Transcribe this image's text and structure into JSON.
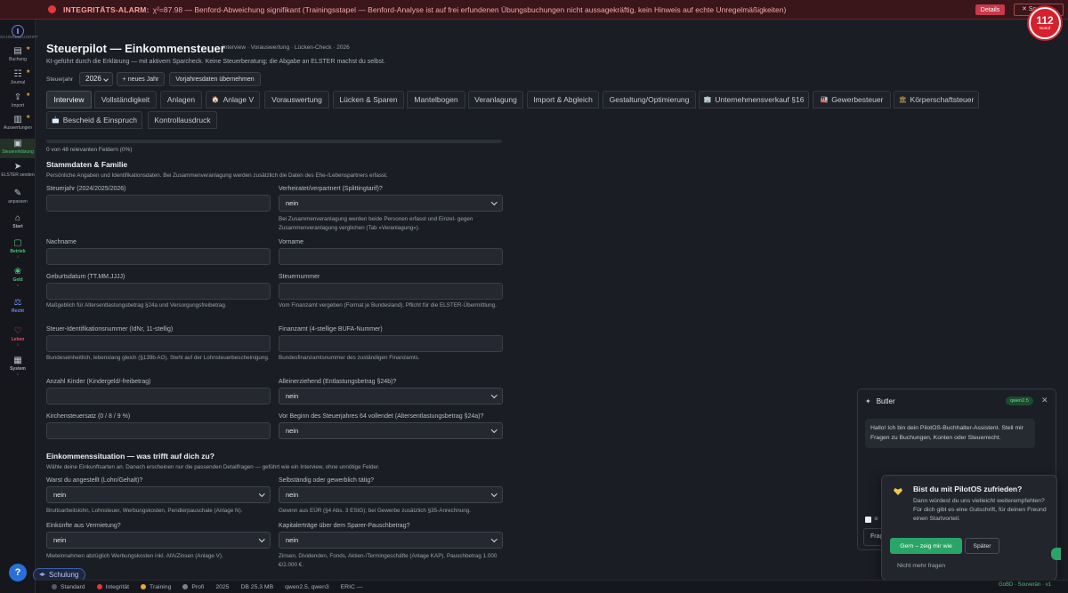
{
  "alarm": {
    "title": "INTEGRITÄTS-ALARM:",
    "message": "χ²=87.98 — Benford-Abweichung signifikant (Trainingsstapel — Benford-Analyse ist auf frei erfundenen Übungsbuchungen nicht aussagekräftig, kein Hinweis auf echte Unregelmäßigkeiten)",
    "details_label": "Details",
    "close_label": "✕ Sc",
    "badge_number": "112",
    "badge_label": "Notruf"
  },
  "sidebar": {
    "header": "SCHNELLZUGRIFF",
    "items": [
      {
        "label": "Buchung",
        "icon": "document-icon",
        "glyph": "▤"
      },
      {
        "label": "Journal",
        "icon": "journal-icon",
        "glyph": "☷"
      },
      {
        "label": "Import",
        "icon": "import-icon",
        "glyph": "⇪"
      },
      {
        "label": "Auswertungen",
        "icon": "chart-icon",
        "glyph": "▥"
      },
      {
        "label": "Steuererklärung",
        "icon": "tax-document-icon",
        "glyph": "▣"
      },
      {
        "label": "ELSTER senden",
        "icon": "send-icon",
        "glyph": "➤"
      },
      {
        "label": "anpassen",
        "icon": "pencil-icon",
        "glyph": "✎"
      }
    ],
    "groups": [
      {
        "label": "Start",
        "icon": "home-icon",
        "glyph": "⌂",
        "sub": ""
      },
      {
        "label": "Betrieb",
        "icon": "briefcase-icon",
        "glyph": "▢",
        "sub": "1"
      },
      {
        "label": "Geld",
        "icon": "money-icon",
        "glyph": "❀",
        "sub": "1"
      },
      {
        "label": "Recht",
        "icon": "law-icon",
        "glyph": "⚖",
        "sub": ""
      },
      {
        "label": "Leben",
        "icon": "heart-icon",
        "glyph": "♡",
        "sub": "1"
      },
      {
        "label": "System",
        "icon": "grid-icon",
        "glyph": "▦",
        "sub": "1"
      }
    ],
    "help_label": "?",
    "training_label": "Schulung"
  },
  "header": {
    "title": "Steuerpilot — Einkommensteuer",
    "breadcrumb": "Interview · Vorauswertung · Lücken-Check · 2026",
    "lead": "KI-geführt durch die Erklärung — mit aktivem Sparcheck. Keine Steuerberatung; die Abgabe an ELSTER machst du selbst.",
    "year_label": "Steuerjahr",
    "year_value": "2026",
    "new_year_label": "+ neues Jahr",
    "prior_year_label": "Vorjahresdaten übernehmen"
  },
  "tabs": [
    {
      "label": "Interview",
      "emoji": ""
    },
    {
      "label": "Vollständigkeit",
      "emoji": ""
    },
    {
      "label": "Anlagen",
      "emoji": ""
    },
    {
      "label": "Anlage V",
      "emoji": "🏠"
    },
    {
      "label": "Vorauswertung",
      "emoji": ""
    },
    {
      "label": "Lücken & Sparen",
      "emoji": ""
    },
    {
      "label": "Mantelbogen",
      "emoji": ""
    },
    {
      "label": "Veranlagung",
      "emoji": ""
    },
    {
      "label": "Import & Abgleich",
      "emoji": ""
    },
    {
      "label": "Gestaltung/Optimierung",
      "emoji": ""
    },
    {
      "label": "Unternehmensverkauf §16",
      "emoji": "🏢"
    },
    {
      "label": "Gewerbesteuer",
      "emoji": "🏭"
    },
    {
      "label": "Körperschaftsteuer",
      "emoji": "🏛"
    },
    {
      "label": "Bescheid & Einspruch",
      "emoji": "📩"
    },
    {
      "label": "Kontrollausdruck",
      "emoji": ""
    }
  ],
  "progress": {
    "text": "0 von 48 relevanten Feldern (0%)",
    "fraction": 0
  },
  "section1": {
    "title": "Stammdaten & Familie",
    "desc": "Persönliche Angaben und Identifikationsdaten. Bei Zusammenveranlagung werden zusätzlich die Daten des Ehe-/Lebenspartners erfasst.",
    "fields": {
      "steuerjahr": {
        "label": "Steuerjahr (2024/2025/2026)",
        "value": ""
      },
      "verheiratet": {
        "label": "Verheiratet/verpartnert (Splittingtarif)?",
        "value": "nein",
        "hint": "Bei Zusammenveranlagung werden beide Personen erfasst und Einzel- gegen Zusammenveranlagung verglichen (Tab »Veranlagung«)."
      },
      "nachname": {
        "label": "Nachname",
        "value": ""
      },
      "vorname": {
        "label": "Vorname",
        "value": ""
      },
      "geburtsdatum": {
        "label": "Geburtsdatum (TT.MM.JJJJ)",
        "value": "",
        "hint": "Maßgeblich für Altersentlastungsbetrag §24a und Versorgungsfreibetrag."
      },
      "steuernummer": {
        "label": "Steuernummer",
        "value": "",
        "hint": "Vom Finanzamt vergeben (Format je Bundesland). Pflicht für die ELSTER-Übermittlung."
      },
      "idnr": {
        "label": "Steuer-Identifikationsnummer (IdNr, 11-stellig)",
        "value": "",
        "hint": "Bundeseinheitlich, lebenslang gleich (§139b AO). Steht auf der Lohnsteuerbescheinigung."
      },
      "finanzamt": {
        "label": "Finanzamt (4-stellige BUFA-Nummer)",
        "value": "",
        "hint": "Bundesfinanzamtsnummer des zuständigen Finanzamts."
      },
      "kinder": {
        "label": "Anzahl Kinder (Kindergeld/-freibetrag)",
        "value": ""
      },
      "alleinerziehend": {
        "label": "Alleinerziehend (Entlastungsbetrag §24b)?",
        "value": "nein"
      },
      "kirchensteuer": {
        "label": "Kirchensteuersatz (0 / 8 / 9 %)",
        "value": ""
      },
      "vollendet64": {
        "label": "Vor Beginn des Steuerjahres 64 vollendet (Altersentlastungsbetrag §24a)?",
        "value": "nein"
      }
    }
  },
  "section2": {
    "title": "Einkommenssituation — was trifft auf dich zu?",
    "desc": "Wähle deine Einkunftsarten an. Danach erscheinen nur die passenden Detailfragen — geführt wie ein Interview, ohne unnötige Felder.",
    "fields": {
      "angestellt": {
        "label": "Warst du angestellt (Lohn/Gehalt)?",
        "value": "nein",
        "hint": "Bruttoarbeitslohn, Lohnsteuer, Werbungskosten, Pendlerpauschale (Anlage N)."
      },
      "selbststaendig": {
        "label": "Selbständig oder gewerblich tätig?",
        "value": "nein",
        "hint": "Gewinn aus EÜR (§4 Abs. 3 EStG); bei Gewerbe zusätzlich §35-Anrechnung."
      },
      "vermietung": {
        "label": "Einkünfte aus Vermietung?",
        "value": "nein",
        "hint": "Mieteinnahmen abzüglich Werbungskosten inkl. AfA/Zinsen (Anlage V)."
      },
      "kapital": {
        "label": "Kapitalerträge über dem Sparer-Pauschbetrag?",
        "value": "nein",
        "hint": "Zinsen, Dividenden, Fonds, Aktien-/Termingeschäfte (Anlage KAP). Pauschbetrag 1.000 €/2.000 €."
      }
    }
  },
  "butler": {
    "title": "Butler",
    "model": "qwen2.5",
    "close": "✕",
    "message": "Hallo! Ich bin dein PilotOS-Buchhalter-Assistent. Stell mir Fragen zu Buchungen, Konten oder Steuerrecht.",
    "checkbox_text": "⊕",
    "input_prefix": "Frag"
  },
  "survey": {
    "title": "Bist du mit PilotOS zufrieden?",
    "text": "Dann würdest du uns vielleicht weiterempfehlen? Für dich gibt es eine Gutschrift, für deinen Freund einen Startvorteil.",
    "yes_label": "Gern – zeig mir wie",
    "later_label": "Später",
    "never_label": "Nicht mehr fragen"
  },
  "statusbar": {
    "items": [
      {
        "label": "Standard",
        "color": "#555b66"
      },
      {
        "label": "Integrität",
        "color": "#e03a3a"
      },
      {
        "label": "Training",
        "color": "#e3a93b"
      },
      {
        "label": "Profi",
        "color": "#7c8390"
      },
      {
        "label": "2025",
        "color": ""
      },
      {
        "label": "DB 25.3 MB",
        "color": ""
      },
      {
        "label": "qwen2.5, qwen3",
        "color": ""
      },
      {
        "label": "ERIC —",
        "color": ""
      }
    ],
    "right": "GoBD · Souverän · v1"
  },
  "colors": {
    "accent_green": "#2aa56a",
    "alarm_red": "#d6202d"
  }
}
